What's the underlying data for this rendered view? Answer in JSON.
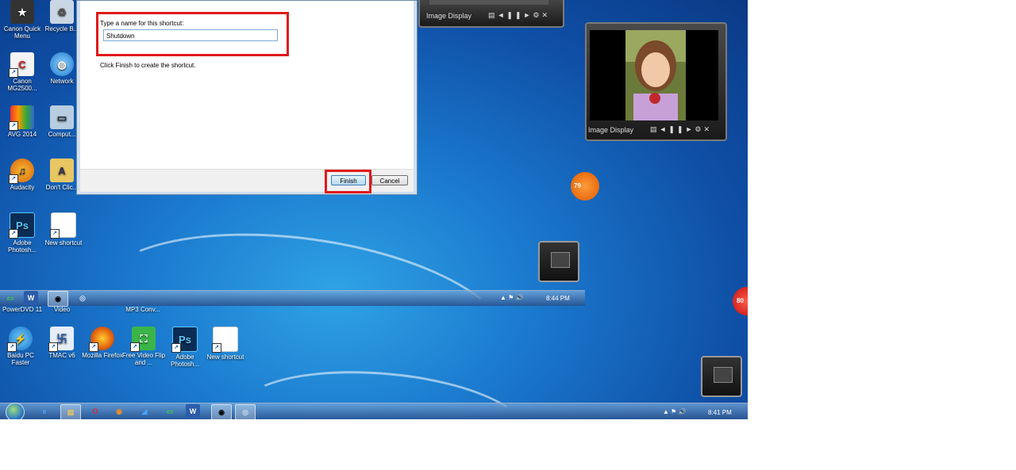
{
  "dialog": {
    "prompt_label": "Type a name for this shortcut:",
    "name_value": "Shutdown",
    "instruction": "Click Finish to create the shortcut.",
    "finish_label": "Finish",
    "cancel_label": "Cancel"
  },
  "desktop_icons_top": [
    {
      "label": "Canon Quick Menu",
      "icon": "canon-icon"
    },
    {
      "label": "Recycle B...",
      "icon": "recycle-bin-icon"
    },
    {
      "label": "Canon MG2500...",
      "icon": "canon-icon"
    },
    {
      "label": "Network",
      "icon": "network-icon"
    },
    {
      "label": "AVG 2014",
      "icon": "avg-icon"
    },
    {
      "label": "Comput...",
      "icon": "computer-icon"
    },
    {
      "label": "Audacity",
      "icon": "audacity-icon"
    },
    {
      "label": "Don't Clic...",
      "icon": "folder-icon"
    },
    {
      "label": "Adobe Photosh...",
      "icon": "photoshop-icon"
    },
    {
      "label": "New shortcut",
      "icon": "shortcut-icon"
    }
  ],
  "desktop_icons_bottom": [
    {
      "label": "PowerDVD 11",
      "icon": "powerdvd-icon"
    },
    {
      "label": "Video",
      "icon": "video-icon"
    },
    {
      "label": "MP3 Conv...",
      "icon": "mp3-icon"
    },
    {
      "label": "Baidu PC Faster",
      "icon": "baidu-icon"
    },
    {
      "label": "TMAC v6",
      "icon": "tmac-icon"
    },
    {
      "label": "Mozilla Firefox",
      "icon": "firefox-icon"
    },
    {
      "label": "Free Video Flip and ...",
      "icon": "video-flip-icon"
    },
    {
      "label": "Adobe Photosh...",
      "icon": "photoshop-icon"
    },
    {
      "label": "New shortcut",
      "icon": "shortcut-icon"
    }
  ],
  "gadgets": {
    "image_display_title": "Image Display",
    "badge_top": "79",
    "badge_bottom": "80"
  },
  "taskbar_inner": {
    "time": "8:44 PM"
  },
  "taskbar_main": {
    "time": "8:41 PM"
  },
  "colors": {
    "highlight_red": "#e01a1a",
    "desktop_blue": "#1a78cd"
  }
}
